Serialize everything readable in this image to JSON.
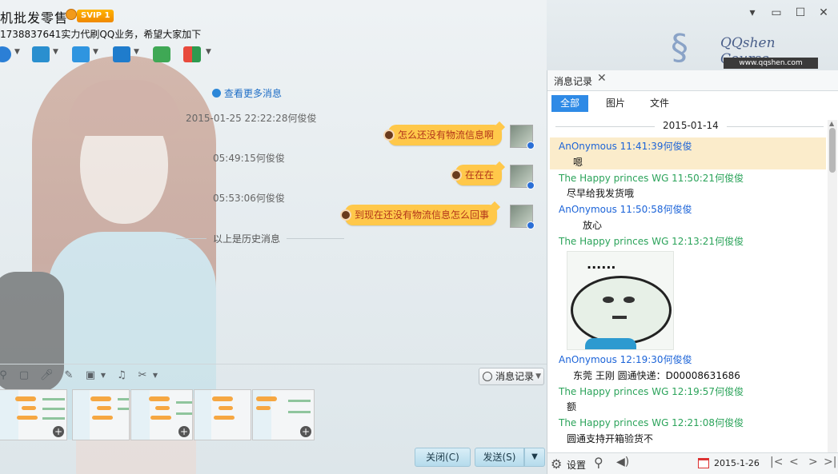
{
  "window": {
    "title": "机批发零售",
    "vip_label": "SVIP 1",
    "subtitle": "1738837641实力代刷QQ业务，希望大家加下",
    "controls": [
      "▾",
      "▭",
      "☐",
      "✕"
    ]
  },
  "toolbar": {
    "items": [
      {
        "icon": "video-call-icon",
        "color": "#2b7fd6"
      },
      {
        "icon": "chart-icon",
        "color": "#2a8fcf"
      },
      {
        "icon": "folder-transfer-icon",
        "color": "#2f95e0"
      },
      {
        "icon": "remote-desktop-icon",
        "color": "#1f7ccc"
      },
      {
        "icon": "add-chat-icon",
        "color": "#3fa855"
      },
      {
        "icon": "apps-grid-icon",
        "color": "#e84a3c"
      }
    ]
  },
  "chat": {
    "more_messages": "查看更多消息",
    "messages": [
      {
        "timestamp": "2015-01-25 22:22:28何俊俊",
        "text": "怎么还没有物流信息啊"
      },
      {
        "timestamp": "05:49:15何俊俊",
        "text": "在在在"
      },
      {
        "timestamp": "05:53:06何俊俊",
        "text": "到现在还没有物流信息怎么回事"
      }
    ],
    "history_label": "以上是历史消息"
  },
  "editbar": {
    "tools": [
      "font-icon",
      "emoji-icon",
      "voice-icon",
      "edit-icon",
      "image-icon",
      "music-icon",
      "scissors-icon"
    ],
    "msglog_label": "消息记录"
  },
  "actions": {
    "close_label": "关闭(C)",
    "send_label": "发送(S)",
    "send_dropdown": "▼"
  },
  "branding": {
    "name": "QQshen Course",
    "url": "www.qqshen.com"
  },
  "history": {
    "tab_label": "消息记录",
    "filters": [
      "全部",
      "图片",
      "文件"
    ],
    "active_filter": "全部",
    "date": "2015-01-14",
    "records": [
      {
        "sender": "AnOnymous 11:41:39何俊俊",
        "side": "blue",
        "text": "嗯"
      },
      {
        "sender": "The Happy princes  WG 11:50:21何俊俊",
        "side": "green",
        "text": "尽早给我发货哦"
      },
      {
        "sender": "AnOnymous 11:50:58何俊俊",
        "side": "blue",
        "text": "放心"
      },
      {
        "sender": "The Happy princes  WG 12:13:21何俊俊",
        "side": "green",
        "text": ""
      },
      {
        "sender": "AnOnymous 12:19:30何俊俊",
        "side": "blue",
        "text": "东莞 王刚 圆通快递：D00008631686"
      },
      {
        "sender": "The Happy princes  WG 12:19:57何俊俊",
        "side": "green",
        "text": "额"
      },
      {
        "sender": "The Happy princes  WG 12:21:08何俊俊",
        "side": "green",
        "text": "圆通支持开箱验货不"
      }
    ],
    "meme_text": "......",
    "settings_label": "设置",
    "current_date": "2015-1-26",
    "nav": [
      "|<",
      "<",
      ">",
      ">|"
    ]
  }
}
